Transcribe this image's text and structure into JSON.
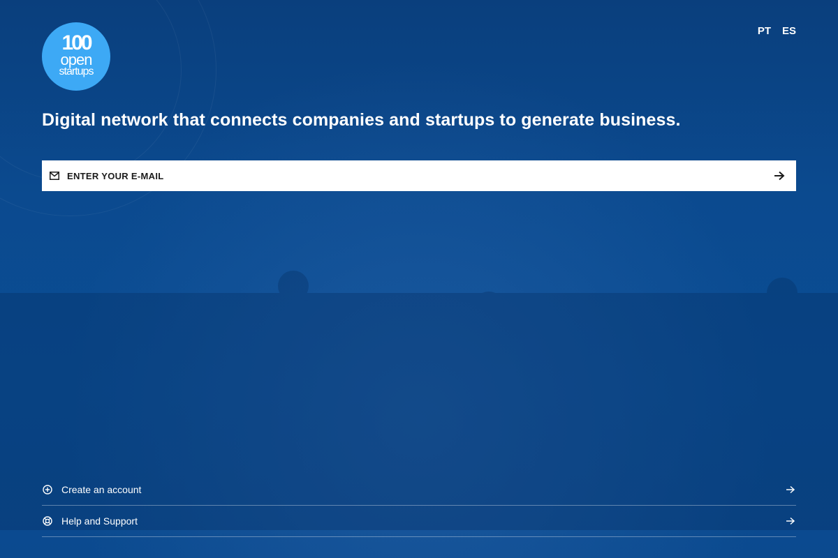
{
  "header": {
    "logo": {
      "line1": "100",
      "line2": "open",
      "line3": "startups",
      "color": "#3da9f5"
    },
    "languages": [
      "PT",
      "ES"
    ]
  },
  "headline": "Digital network that connects companies and startups to generate business.",
  "email_form": {
    "icon": "mail-icon",
    "placeholder": "ENTER YOUR E-MAIL",
    "value": "",
    "submit_icon": "arrow-right-icon"
  },
  "footer": {
    "links": [
      {
        "label": "Create an account",
        "icon": "plus-circle-icon"
      },
      {
        "label": "Help and Support",
        "icon": "lifebuoy-icon"
      }
    ]
  },
  "colors": {
    "background": "#0b4a8f",
    "accent": "#3da9f5"
  }
}
